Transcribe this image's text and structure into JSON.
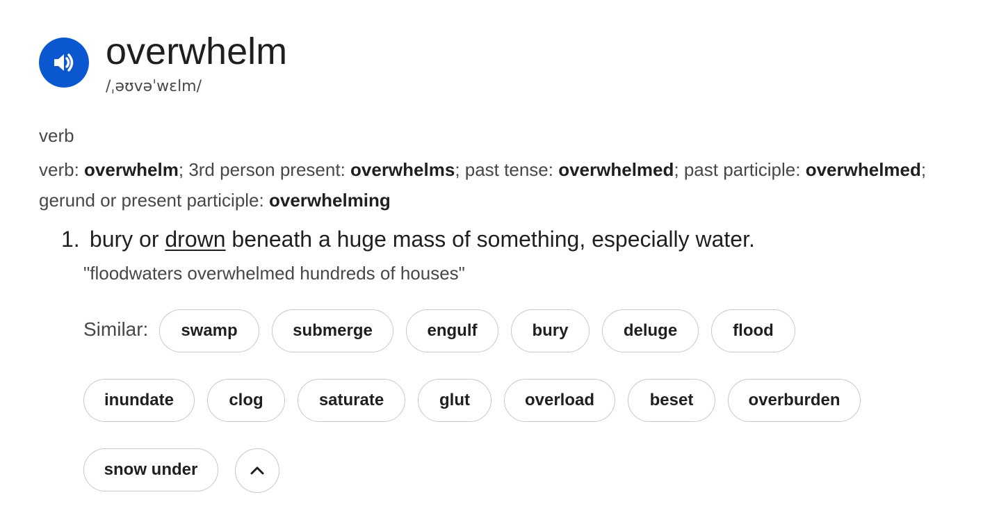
{
  "entry": {
    "word": "overwhelm",
    "phonetic": "/ˌəʊvəˈwɛlm/",
    "audio_icon": "speaker-icon",
    "part_of_speech": "verb"
  },
  "forms": {
    "verb_label": "verb",
    "verb_value": "overwhelm",
    "third_person_label": "3rd person present",
    "third_person_value": "overwhelms",
    "past_tense_label": "past tense",
    "past_tense_value": "overwhelmed",
    "past_participle_label": "past participle",
    "past_participle_value": "overwhelmed",
    "gerund_label": "gerund or present participle",
    "gerund_value": "overwhelming"
  },
  "definition": {
    "number": "1.",
    "text_before": "bury or",
    "link_word": "drown",
    "text_after": "beneath a huge mass of something, especially water.",
    "example": "\"floodwaters overwhelmed hundreds of houses\""
  },
  "similar": {
    "label": "Similar:",
    "words": [
      "swamp",
      "submerge",
      "engulf",
      "bury",
      "deluge",
      "flood",
      "inundate",
      "clog",
      "saturate",
      "glut",
      "overload",
      "beset",
      "overburden",
      "snow under"
    ],
    "collapse_icon": "chevron-up-icon"
  },
  "colors": {
    "accent": "#0b57d0",
    "text_primary": "#1f1f1f",
    "text_secondary": "#474747",
    "chip_border": "#c7c7c7"
  }
}
